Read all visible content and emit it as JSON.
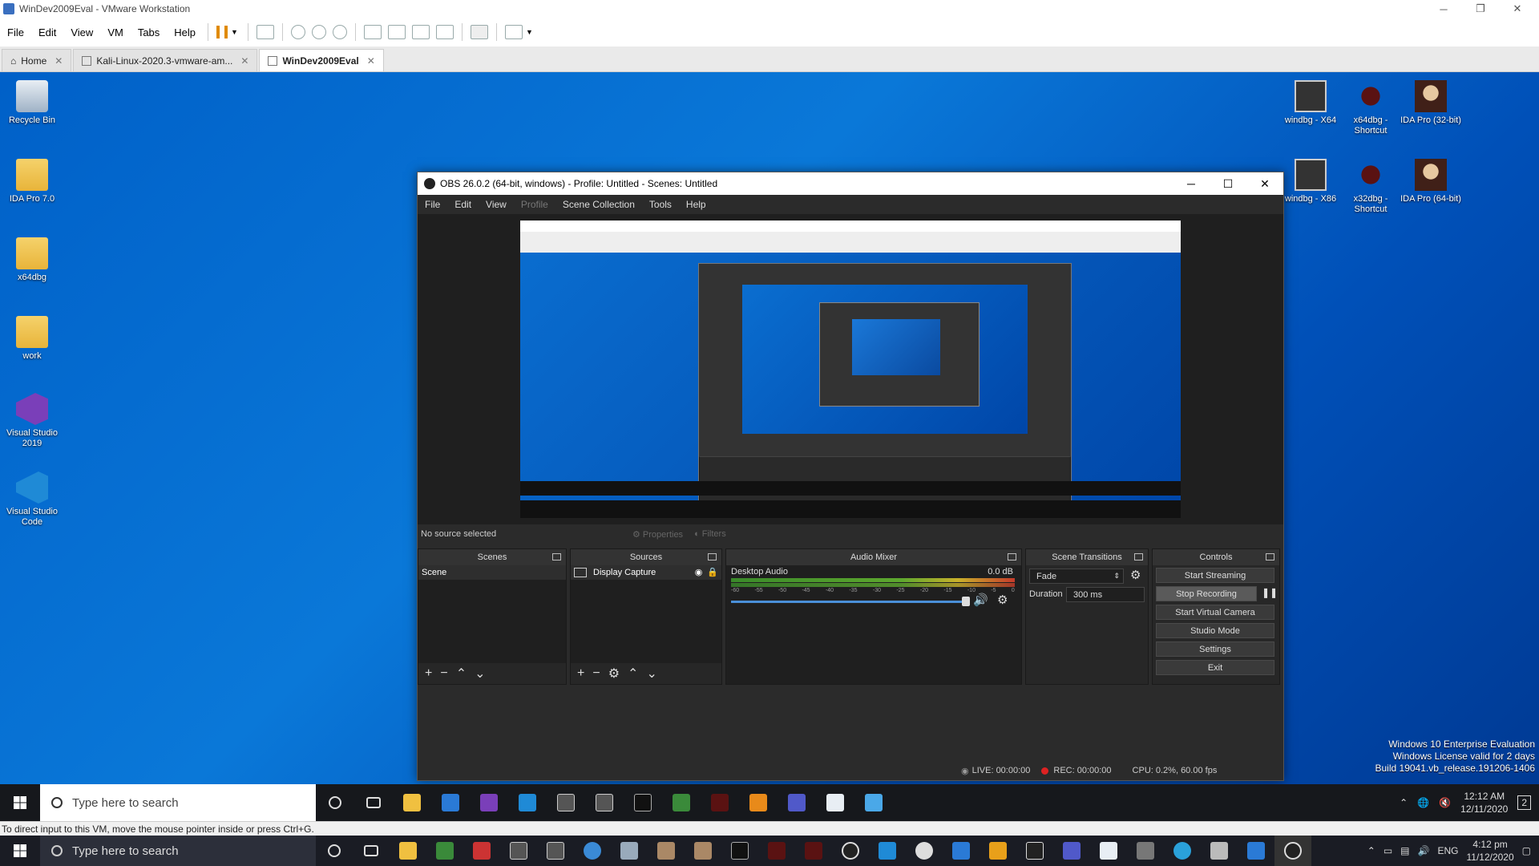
{
  "vmware": {
    "title": "WinDev2009Eval - VMware Workstation",
    "menu": [
      "File",
      "Edit",
      "View",
      "VM",
      "Tabs",
      "Help"
    ],
    "tabs": [
      {
        "label": "Home",
        "active": false
      },
      {
        "label": "Kali-Linux-2020.3-vmware-am...",
        "active": false
      },
      {
        "label": "WinDev2009Eval",
        "active": true
      }
    ],
    "hint": "To direct input to this VM, move the mouse pointer inside or press Ctrl+G."
  },
  "desktop": {
    "left_icons": [
      {
        "label": "Recycle Bin",
        "icon": "recycle-bin-icon"
      },
      {
        "label": "IDA Pro 7.0",
        "icon": "folder-icon"
      },
      {
        "label": "x64dbg",
        "icon": "folder-icon"
      },
      {
        "label": "work",
        "icon": "folder-icon"
      },
      {
        "label": "Visual Studio 2019",
        "icon": "visual-studio-icon"
      },
      {
        "label": "Visual Studio Code",
        "icon": "vscode-icon"
      }
    ],
    "right_icons": [
      {
        "label": "windbg - X64",
        "icon": "windbg-icon"
      },
      {
        "label": "x64dbg - Shortcut",
        "icon": "x64dbg-icon"
      },
      {
        "label": "IDA Pro (32-bit)",
        "icon": "ida-icon"
      },
      {
        "label": "windbg - X86",
        "icon": "windbg-icon"
      },
      {
        "label": "x32dbg - Shortcut",
        "icon": "x32dbg-icon"
      },
      {
        "label": "IDA Pro (64-bit)",
        "icon": "ida-icon"
      }
    ],
    "watermark": {
      "line1": "Windows 10 Enterprise Evaluation",
      "line2": "Windows License valid for 2 days",
      "line3": "Build 19041.vb_release.191206-1406"
    }
  },
  "obs": {
    "title": "OBS 26.0.2 (64-bit, windows) - Profile: Untitled - Scenes: Untitled",
    "menu": [
      "File",
      "Edit",
      "View",
      "Profile",
      "Scene Collection",
      "Tools",
      "Help"
    ],
    "no_source": "No source selected",
    "properties": "Properties",
    "filters": "Filters",
    "scenes": {
      "header": "Scenes",
      "items": [
        "Scene"
      ]
    },
    "sources": {
      "header": "Sources",
      "items": [
        "Display Capture"
      ]
    },
    "mixer": {
      "header": "Audio Mixer",
      "channel": "Desktop Audio",
      "db": "0.0 dB",
      "scale": [
        "-60",
        "-55",
        "-50",
        "-45",
        "-40",
        "-35",
        "-30",
        "-25",
        "-20",
        "-15",
        "-10",
        "-5",
        "0"
      ]
    },
    "transitions": {
      "header": "Scene Transitions",
      "type": "Fade",
      "duration_label": "Duration",
      "duration": "300 ms"
    },
    "controls": {
      "header": "Controls",
      "buttons": [
        "Start Streaming",
        "Stop Recording",
        "Start Virtual Camera",
        "Studio Mode",
        "Settings",
        "Exit"
      ]
    },
    "status": {
      "live": "LIVE: 00:00:00",
      "rec": "REC: 00:00:00",
      "cpu": "CPU: 0.2%, 60.00 fps"
    }
  },
  "inner_taskbar": {
    "search": "Type here to search",
    "time": "12:12 AM",
    "date": "12/11/2020",
    "notif": "2"
  },
  "host_taskbar": {
    "search": "Type here to search",
    "lang": "ENG",
    "time": "4:12 pm",
    "date": "11/12/2020"
  }
}
